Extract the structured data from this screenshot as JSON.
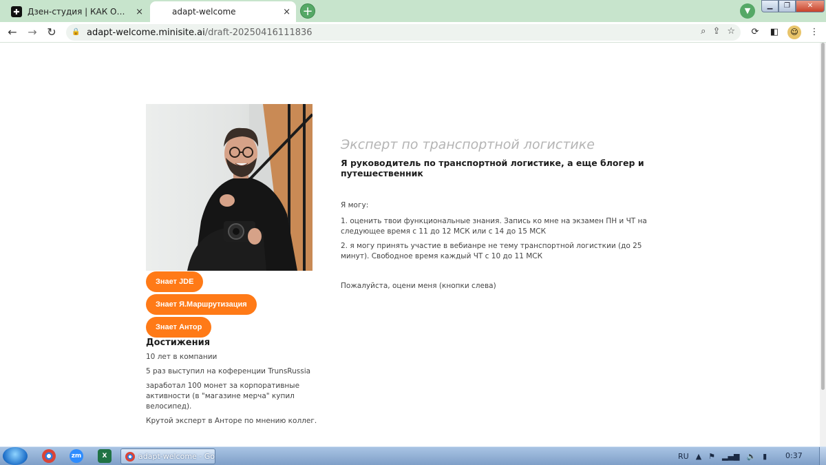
{
  "browser": {
    "tabs": [
      {
        "title": "Дзен-студия | КАК ОФОРМИТЬ",
        "close": "×"
      },
      {
        "title": "adapt-welcome",
        "close": "×"
      }
    ],
    "new_tab": "+",
    "url_host": "adapt-welcome.minisite.ai",
    "url_path": "/draft-20250416111836"
  },
  "page": {
    "skills": [
      "Знает JDE",
      "Знает Я.Маршрутизация",
      "Знает Антор"
    ],
    "achievements": {
      "title": "Достижения",
      "items": [
        "10 лет в компании",
        "5 раз выступил на коференции TrunsRussia",
        "заработал 100 монет за корпоративные активности (в \"магазине мерча\" купил велосипед).",
        "Крутой эксперт в Анторе по мнению коллег."
      ]
    },
    "headline": "Эксперт по транспортной логистике",
    "subheadline": "Я руководитель по транспортной логистике, а еще блогер и путешественник",
    "can_label": "Я могу:",
    "can_items": [
      "1. оценить твои функциональные знания. Запись ко мне на экзамен ПН и ЧТ на следующее время с 11 до 12 МСК или с 14 до 15 МСК",
      "2. я могу принять участие в вебианре не тему транспортной логисткии (до 25 минут). Свободное время каждый ЧТ с 10 до 11 МСК"
    ],
    "rate_note": "Пожалуйста, оцени меня (кнопки слева)"
  },
  "taskbar": {
    "zoom_label": "zm",
    "active_window": "adapt-welcome - Go...",
    "lang": "RU",
    "time": "0:37"
  },
  "colors": {
    "accent": "#ff7a17",
    "tabstrip": "#c7e4cc",
    "headline": "#b4b4b4"
  }
}
